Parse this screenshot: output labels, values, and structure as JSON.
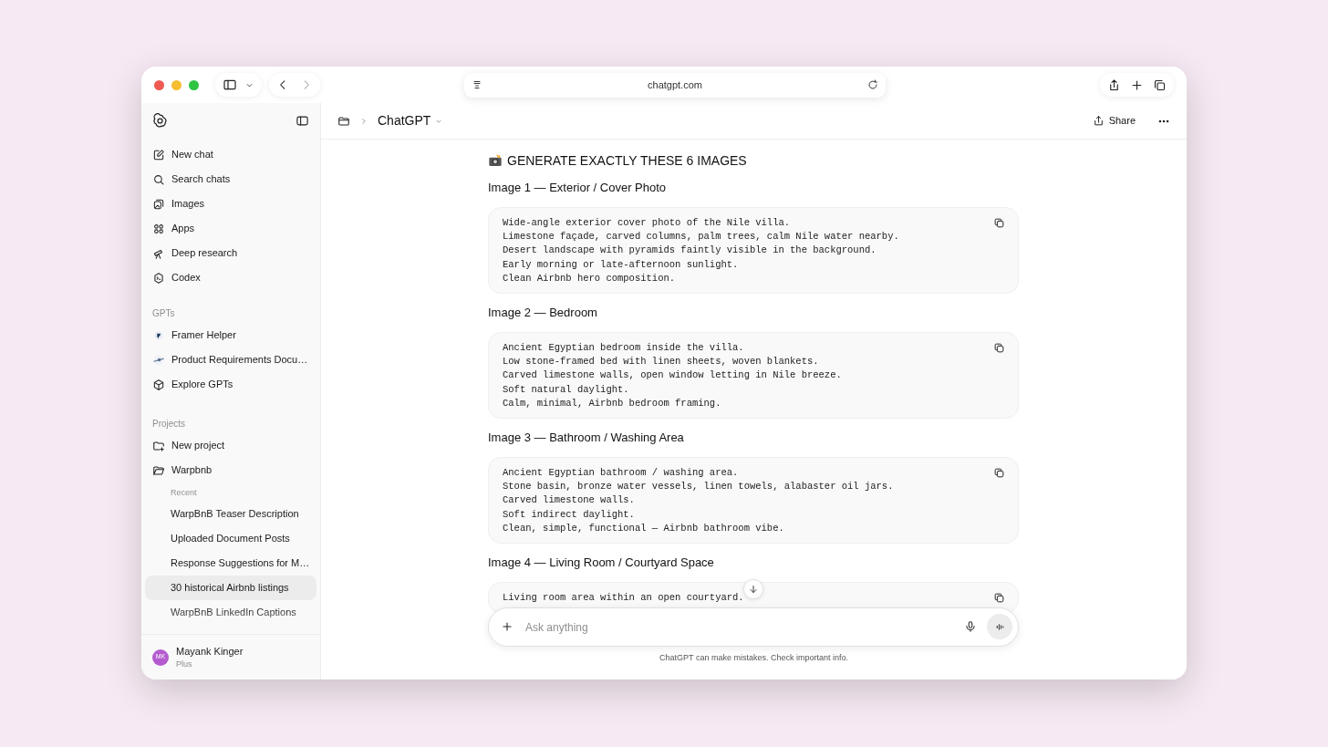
{
  "browser": {
    "url": "chatgpt.com"
  },
  "sidebar": {
    "items": [
      {
        "label": "New chat"
      },
      {
        "label": "Search chats"
      },
      {
        "label": "Images"
      },
      {
        "label": "Apps"
      },
      {
        "label": "Deep research"
      },
      {
        "label": "Codex"
      }
    ],
    "gpts": {
      "title": "GPTs",
      "items": [
        {
          "label": "Framer Helper"
        },
        {
          "label": "Product Requirements Docu…"
        },
        {
          "label": "Explore GPTs"
        }
      ]
    },
    "projects": {
      "title": "Projects",
      "items": [
        {
          "label": "New project"
        },
        {
          "label": "Warpbnb"
        }
      ],
      "recent_label": "Recent",
      "recent": [
        {
          "label": "WarpBnB Teaser Description",
          "selected": false
        },
        {
          "label": "Uploaded Document Posts",
          "selected": false
        },
        {
          "label": "Response Suggestions for M…",
          "selected": false
        },
        {
          "label": "30 historical Airbnb listings",
          "selected": true
        },
        {
          "label": "WarpBnB LinkedIn Captions",
          "selected": false
        }
      ]
    },
    "user": {
      "initials": "MK",
      "name": "Mayank Kinger",
      "plan": "Plus"
    }
  },
  "header": {
    "title": "ChatGPT",
    "share": "Share"
  },
  "chat": {
    "heading": "GENERATE EXACTLY THESE 6 IMAGES",
    "sections": [
      {
        "title": "Image 1 — Exterior / Cover Photo",
        "lines": [
          "Wide-angle exterior cover photo of the Nile villa.",
          "Limestone façade, carved columns, palm trees, calm Nile water nearby.",
          "Desert landscape with pyramids faintly visible in the background.",
          "Early morning or late-afternoon sunlight.",
          "Clean Airbnb hero composition."
        ]
      },
      {
        "title": "Image 2 — Bedroom",
        "lines": [
          "Ancient Egyptian bedroom inside the villa.",
          "Low stone-framed bed with linen sheets, woven blankets.",
          "Carved limestone walls, open window letting in Nile breeze.",
          "Soft natural daylight.",
          "Calm, minimal, Airbnb bedroom framing."
        ]
      },
      {
        "title": "Image 3 — Bathroom / Washing Area",
        "lines": [
          "Ancient Egyptian bathroom / washing area.",
          "Stone basin, bronze water vessels, linen towels, alabaster oil jars.",
          "Carved limestone walls.",
          "Soft indirect daylight.",
          "Clean, simple, functional — Airbnb bathroom vibe."
        ]
      },
      {
        "title": "Image 4 — Living Room / Courtyard Space",
        "lines": [
          "Living room area within an open courtyard."
        ]
      }
    ]
  },
  "composer": {
    "placeholder": "Ask anything",
    "disclaimer": "ChatGPT can make mistakes. Check important info."
  }
}
